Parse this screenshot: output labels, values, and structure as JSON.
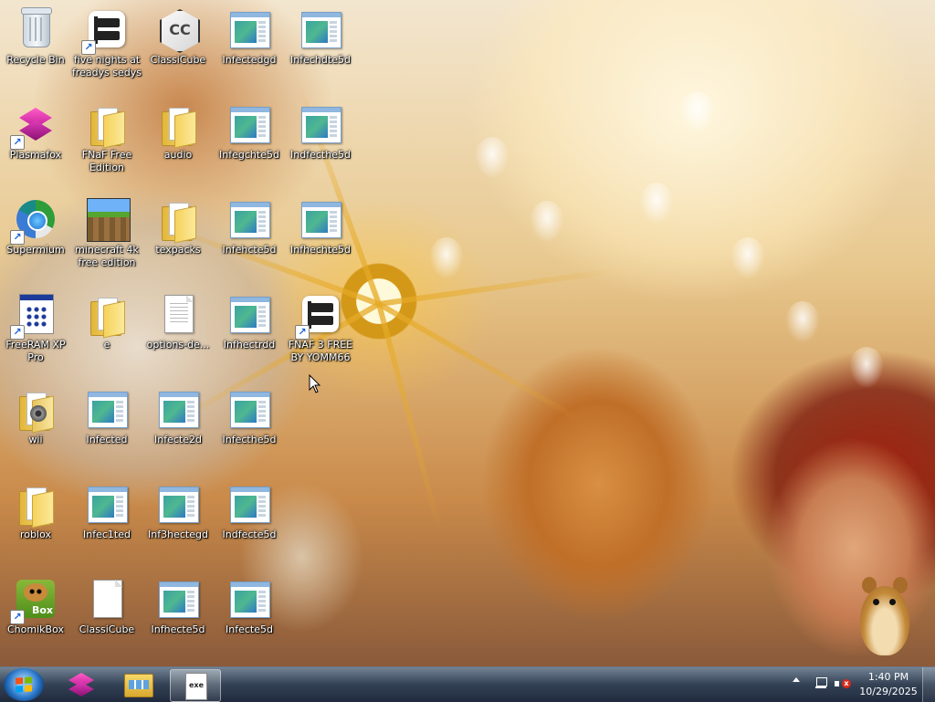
{
  "desktop": {
    "icons": [
      {
        "label": "Recycle Bin",
        "icon": "recycle-bin-icon",
        "shortcut": false
      },
      {
        "label": "five nights at freadys sedys",
        "icon": "fnaf-flag-icon",
        "shortcut": true
      },
      {
        "label": "ClassiCube",
        "icon": "classicube-icon",
        "shortcut": false
      },
      {
        "label": "Infectedgd",
        "icon": "exe-window-icon",
        "shortcut": false
      },
      {
        "label": "Infechdte5d",
        "icon": "exe-window-icon",
        "shortcut": false
      },
      {
        "label": "Plasmafox",
        "icon": "plasmafox-icon",
        "shortcut": true
      },
      {
        "label": "FNaF Free Edition",
        "icon": "folder-icon",
        "shortcut": false
      },
      {
        "label": "audio",
        "icon": "folder-icon",
        "shortcut": false
      },
      {
        "label": "Infegchte5d",
        "icon": "exe-window-icon",
        "shortcut": false
      },
      {
        "label": "Indfecthe5d",
        "icon": "exe-window-icon",
        "shortcut": false
      },
      {
        "label": "Supermium",
        "icon": "supermium-icon",
        "shortcut": true
      },
      {
        "label": "minecraft 4k free edition",
        "icon": "minecraft-icon",
        "shortcut": false
      },
      {
        "label": "texpacks",
        "icon": "folder-icon",
        "shortcut": false
      },
      {
        "label": "Infehcte5d",
        "icon": "exe-window-icon",
        "shortcut": false
      },
      {
        "label": "Infhechte5d",
        "icon": "exe-window-icon",
        "shortcut": false
      },
      {
        "label": "FreeRAM XP Pro",
        "icon": "freeram-icon",
        "shortcut": true
      },
      {
        "label": "e",
        "icon": "folder-icon",
        "shortcut": false
      },
      {
        "label": "options-de...",
        "icon": "text-document-icon",
        "shortcut": false
      },
      {
        "label": "Infhectrdd",
        "icon": "exe-window-icon",
        "shortcut": false
      },
      {
        "label": "FNAF 3 FREE BY YOMM66",
        "icon": "fnaf-flag-icon",
        "shortcut": true
      },
      {
        "label": "wii",
        "icon": "wii-folder-icon",
        "shortcut": false
      },
      {
        "label": "Infected",
        "icon": "exe-window-icon",
        "shortcut": false
      },
      {
        "label": "Infecte2d",
        "icon": "exe-window-icon",
        "shortcut": false
      },
      {
        "label": "Infecthe5d",
        "icon": "exe-window-icon",
        "shortcut": false
      },
      {
        "label": "roblox",
        "icon": "folder-icon",
        "shortcut": false
      },
      {
        "label": "Infec1ted",
        "icon": "exe-window-icon",
        "shortcut": false
      },
      {
        "label": "Inf3hectegd",
        "icon": "exe-window-icon",
        "shortcut": false
      },
      {
        "label": "Indfecte5d",
        "icon": "exe-window-icon",
        "shortcut": false
      },
      {
        "label": "ChomikBox",
        "icon": "chomikbox-icon",
        "shortcut": true
      },
      {
        "label": "ClassiCube",
        "icon": "blank-document-icon",
        "shortcut": false
      },
      {
        "label": "Infhecte5d",
        "icon": "exe-window-icon",
        "shortcut": false
      },
      {
        "label": "Infecte5d",
        "icon": "exe-window-icon",
        "shortcut": false
      }
    ]
  },
  "taskbar": {
    "start_icon": "windows-start-orb-icon",
    "pinned": [
      {
        "icon": "plasmafox-icon",
        "active": false
      },
      {
        "icon": "file-explorer-icon",
        "active": false
      },
      {
        "icon": "document-app-icon",
        "active": true,
        "glyph": "exe"
      }
    ],
    "tray": {
      "show_hidden_icon": "chevron-up-icon",
      "network_icon": "network-icon",
      "volume_icon": "volume-muted-icon",
      "volume_glyph": "x",
      "time": "1:40 PM",
      "date": "10/29/2025"
    }
  },
  "colors": {
    "taskbar": "#283a52",
    "label_text": "#ffffff",
    "shortcut_arrow": "#1a5fd6"
  }
}
